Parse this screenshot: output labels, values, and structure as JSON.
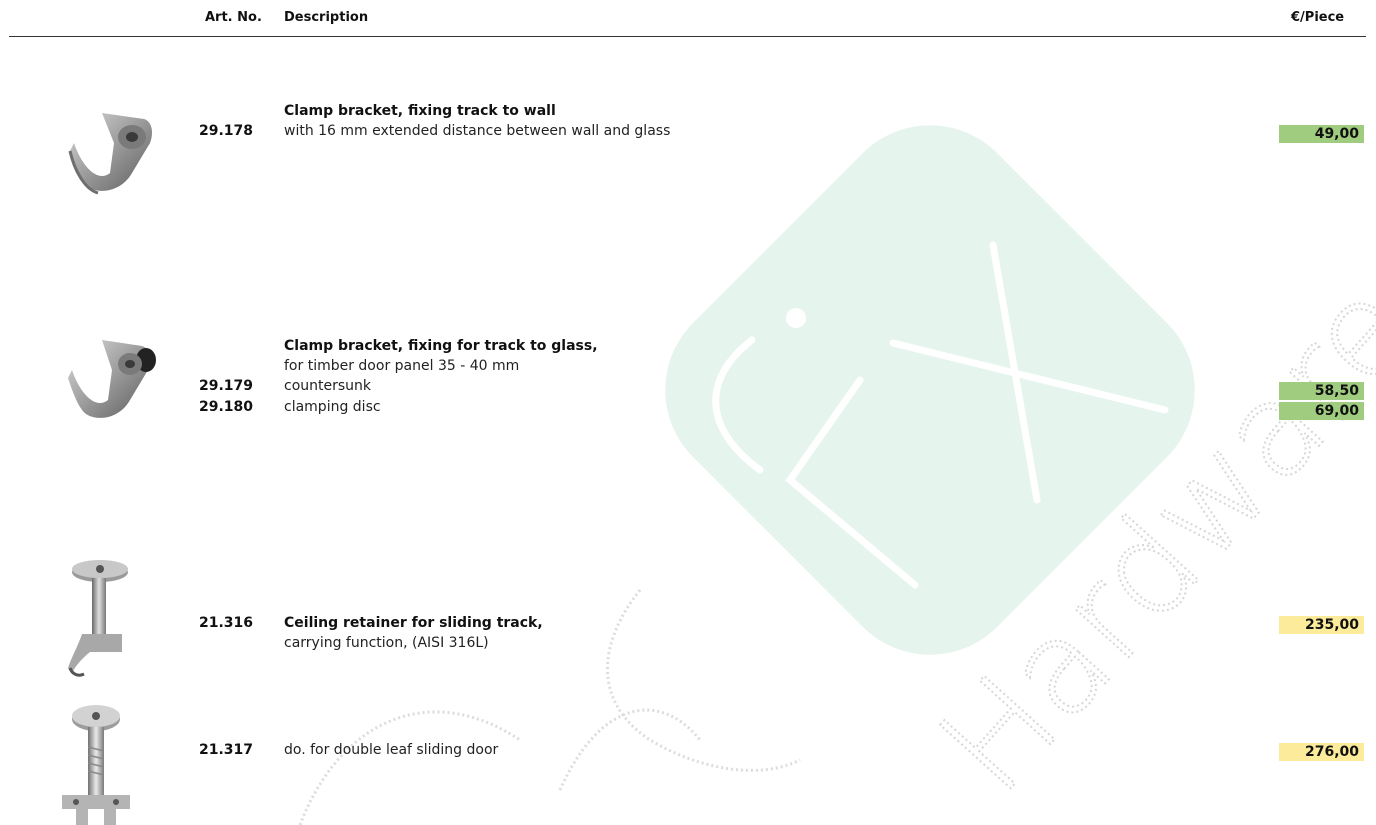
{
  "header": {
    "art_no": "Art. No.",
    "description": "Description",
    "price_unit": "€/Piece"
  },
  "watermark": {
    "text": "Hardware"
  },
  "products": [
    {
      "title": "Clamp bracket, fixing track to wall",
      "lines": [
        {
          "art": "29.178",
          "text": "with 16 mm extended distance between wall and glass",
          "price": "49,00"
        }
      ]
    },
    {
      "title": "Clamp bracket, fixing for track to glass,",
      "subtitle": "for timber door panel 35 - 40 mm",
      "lines": [
        {
          "art": "29.179",
          "text": "countersunk",
          "price": "58,50"
        },
        {
          "art": "29.180",
          "text": "clamping disc",
          "price": "69,00"
        }
      ]
    },
    {
      "title": "Ceiling retainer for sliding track,",
      "lines": [
        {
          "art": "21.316",
          "text": "carrying function, (AISI 316L)",
          "price": "235,00"
        }
      ]
    },
    {
      "lines": [
        {
          "art": "21.317",
          "text": "do. for double leaf sliding door",
          "price": "276,00"
        }
      ]
    }
  ],
  "colors": {
    "price_green": "#9fcc7f",
    "price_yellow": "#fbeb9a",
    "watermark_green": "#e6f4ee"
  }
}
